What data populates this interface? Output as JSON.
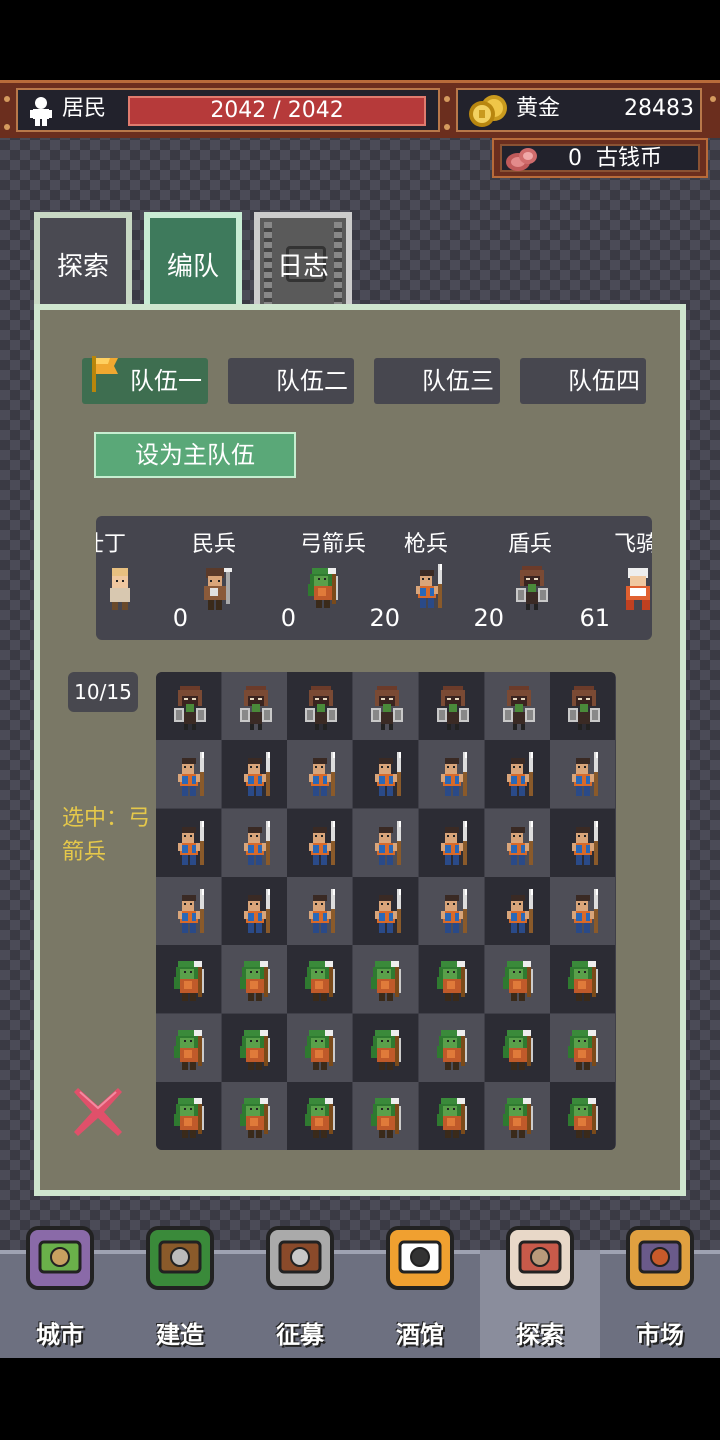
{
  "resources": {
    "population_label": "居民",
    "population_value": "2042 / 2042",
    "gold_label": "黄金",
    "gold_value": "28483",
    "ancient_coin_value": "0",
    "ancient_coin_label": "古钱币"
  },
  "tabs": [
    {
      "label": "探索",
      "state": "normal"
    },
    {
      "label": "编队",
      "state": "active"
    },
    {
      "label": "日志",
      "state": "locked"
    }
  ],
  "teams": [
    {
      "label": "队伍一",
      "selected": true
    },
    {
      "label": "队伍二",
      "selected": false
    },
    {
      "label": "队伍三",
      "selected": false
    },
    {
      "label": "队伍四",
      "selected": false
    }
  ],
  "set_main_team_label": "设为主队伍",
  "units": [
    {
      "name": "壮丁",
      "count": "",
      "sprite": "peasant"
    },
    {
      "name": "民兵",
      "count": "0",
      "sprite": "militia"
    },
    {
      "name": "弓箭兵",
      "count": "0",
      "sprite": "archer"
    },
    {
      "name": "枪兵",
      "count": "20",
      "sprite": "spearman"
    },
    {
      "name": "盾兵",
      "count": "20",
      "sprite": "shieldman"
    },
    {
      "name": "飞骑",
      "count": "61",
      "sprite": "rider"
    }
  ],
  "formation": {
    "capacity": "10/15",
    "selected_text": "选中：弓箭兵",
    "rows": [
      "shieldman",
      "spearman",
      "spearman",
      "spearman",
      "archer",
      "archer",
      "archer"
    ],
    "columns": 7
  },
  "colors": {
    "accent_green": "#5aa878",
    "gold_text": "#e5c84a",
    "hp_red": "#b63a3a",
    "close_red": "#e0506a"
  },
  "nav": [
    {
      "label": "城市",
      "icon": "city-icon"
    },
    {
      "label": "建造",
      "icon": "build-icon"
    },
    {
      "label": "征募",
      "icon": "recruit-icon"
    },
    {
      "label": "酒馆",
      "icon": "tavern-icon"
    },
    {
      "label": "探索",
      "icon": "explore-icon",
      "active": true
    },
    {
      "label": "市场",
      "icon": "market-icon"
    }
  ]
}
